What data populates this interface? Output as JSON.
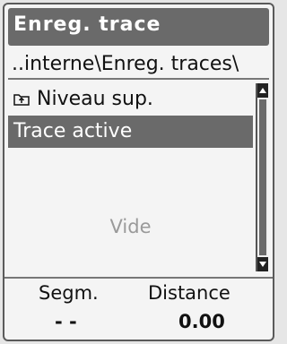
{
  "window": {
    "title": "Enreg. trace"
  },
  "path": "..interne\\Enreg. traces\\",
  "list": {
    "items": [
      {
        "label": "Niveau sup.",
        "icon": "folder-up-icon"
      },
      {
        "label": "Trace active",
        "selected": true
      }
    ],
    "empty_text": "Vide"
  },
  "summary": {
    "headers": {
      "segments": "Segm.",
      "distance": "Distance"
    },
    "values": {
      "segments": "- -",
      "distance": "0.00"
    }
  },
  "colors": {
    "highlight": "#6a6a6a",
    "empty_text": "#9a9a9a"
  }
}
